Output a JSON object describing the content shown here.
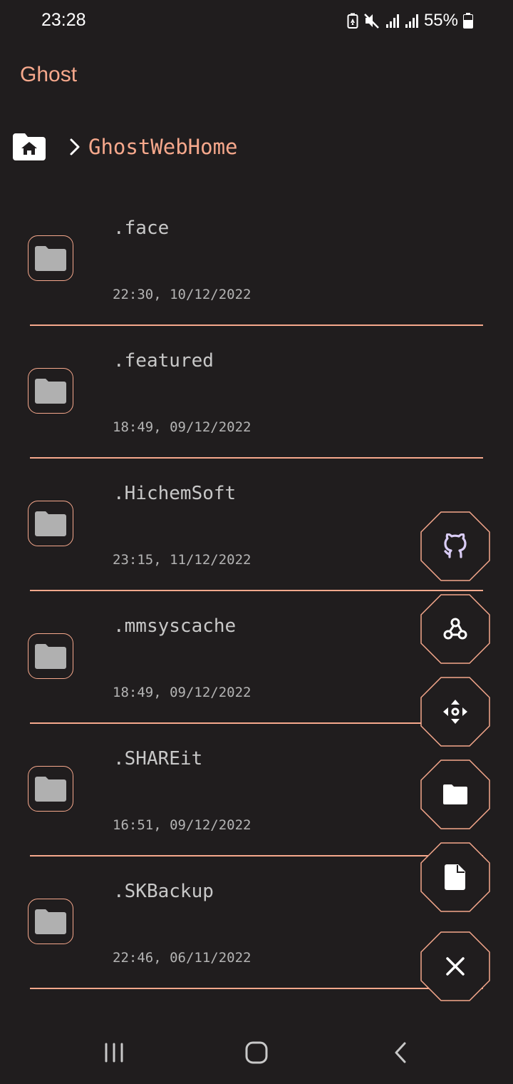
{
  "status_bar": {
    "time": "23:28",
    "battery_percent": "55%",
    "icons": [
      "battery-saver-icon",
      "mute-icon",
      "signal-icon",
      "signal-icon",
      "battery-icon"
    ]
  },
  "app": {
    "title": "Ghost"
  },
  "breadcrumb": {
    "home_icon": "home-folder-icon",
    "separator_icon": "chevron-right-icon",
    "current": "GhostWebHome"
  },
  "files": [
    {
      "name": ".face",
      "date": "22:30, 10/12/2022",
      "icon": "folder-icon"
    },
    {
      "name": ".featured",
      "date": "18:49, 09/12/2022",
      "icon": "folder-icon"
    },
    {
      "name": ".HichemSoft",
      "date": "23:15, 11/12/2022",
      "icon": "folder-icon"
    },
    {
      "name": ".mmsyscache",
      "date": "18:49, 09/12/2022",
      "icon": "folder-icon"
    },
    {
      "name": ".SHAREit",
      "date": "16:51, 09/12/2022",
      "icon": "folder-icon"
    },
    {
      "name": ".SKBackup",
      "date": "22:46, 06/11/2022",
      "icon": "folder-icon"
    }
  ],
  "fab_menu": [
    {
      "icon": "github-icon"
    },
    {
      "icon": "webhook-icon"
    },
    {
      "icon": "move-icon"
    },
    {
      "icon": "new-folder-icon"
    },
    {
      "icon": "new-file-icon"
    },
    {
      "icon": "close-icon"
    }
  ],
  "nav_bar": {
    "icons": [
      "recent-apps-icon",
      "home-icon",
      "back-icon"
    ]
  },
  "colors": {
    "background": "#201d1e",
    "accent": "#f6a88c",
    "text": "#c8c8c8",
    "folder_fill": "#b0b0b0",
    "github_icon": "#d9ccf5"
  }
}
